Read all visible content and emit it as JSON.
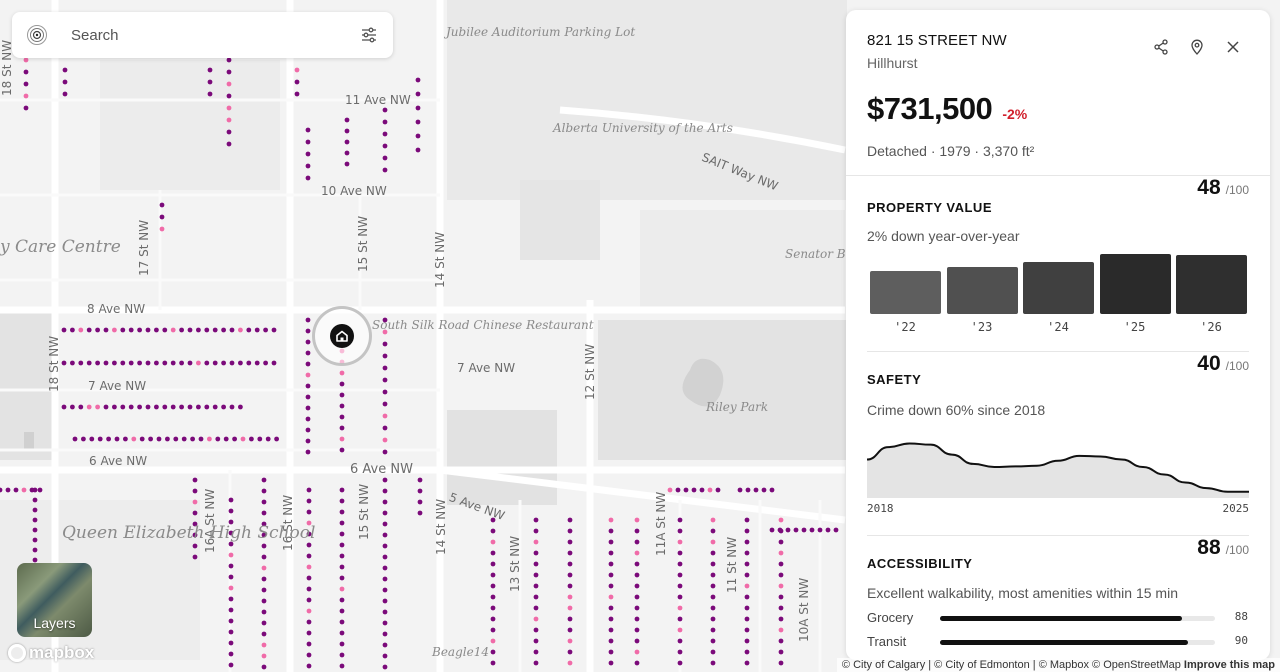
{
  "search": {
    "placeholder": "Search"
  },
  "map": {
    "street_labels": [
      "11 Ave NW",
      "10 Ave NW",
      "8 Ave NW",
      "7 Ave NW",
      "7 Ave NW",
      "6 Ave NW",
      "6 Ave NW",
      "5 Ave NW",
      "SAIT Way NW",
      "17 St NW",
      "15 St NW",
      "14 St NW",
      "18 St NW",
      "18 St NW",
      "12 St NW",
      "16A St NW",
      "16 St NW",
      "15 St NW",
      "14 St NW",
      "13 St NW",
      "11A St NW",
      "11 St NW",
      "10A St NW"
    ],
    "area_labels": [
      "Queen Elizabeth High School",
      "y Care Centre"
    ],
    "poi_labels": [
      "Jubilee Auditorium Parking Lot",
      "Alberta University of the Arts",
      "Senator Burns Roc",
      "Riley Park",
      "South Silk Road Chinese Restaurant",
      "Beagle14"
    ],
    "dot_color_primary": "#7b0a7a",
    "dot_color_secondary": "#f06ba8"
  },
  "layers": {
    "label": "Layers"
  },
  "mapbox": {
    "label": "mapbox"
  },
  "attribution": {
    "text": "© City of Calgary | © City of Edmonton | © Mapbox © OpenStreetMap",
    "improve": "Improve this map"
  },
  "property": {
    "address": "821 15 STREET NW",
    "neighbourhood": "Hillhurst",
    "price": "$731,500",
    "change": "-2%",
    "facts": "Detached · 1979 · 3,370 ft²"
  },
  "property_value": {
    "title": "PROPERTY VALUE",
    "score": "48",
    "out_of": "/100",
    "subtitle": "2% down year-over-year",
    "bars": [
      {
        "label": "'22",
        "level": 0.72,
        "color": "#5e5e5e"
      },
      {
        "label": "'23",
        "level": 0.78,
        "color": "#505050"
      },
      {
        "label": "'24",
        "level": 0.86,
        "color": "#404040"
      },
      {
        "label": "'25",
        "level": 1.0,
        "color": "#2a2a2a"
      },
      {
        "label": "'26",
        "level": 0.98,
        "color": "#2f2f2f"
      }
    ]
  },
  "safety": {
    "title": "SAFETY",
    "score": "40",
    "out_of": "/100",
    "subtitle": "Crime down 60% since 2018",
    "start_label": "2018",
    "end_label": "2025",
    "trend": [
      0.62,
      0.82,
      0.88,
      0.86,
      0.7,
      0.55,
      0.5,
      0.51,
      0.52,
      0.6,
      0.68,
      0.67,
      0.62,
      0.5,
      0.38,
      0.25,
      0.16,
      0.1,
      0.1
    ]
  },
  "accessibility": {
    "title": "ACCESSIBILITY",
    "score": "88",
    "out_of": "/100",
    "subtitle": "Excellent walkability, most amenities within 15 min",
    "amenities": [
      {
        "name": "Grocery",
        "value": "88",
        "level": 0.88
      },
      {
        "name": "Transit",
        "value": "90",
        "level": 0.9
      }
    ]
  }
}
